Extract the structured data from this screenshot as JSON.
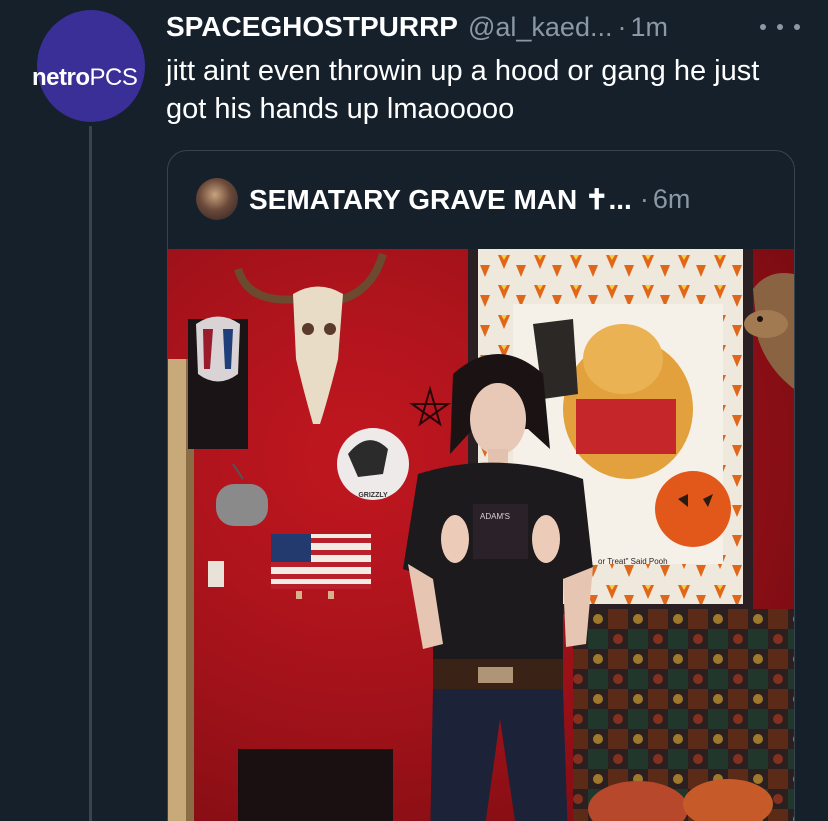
{
  "tweet": {
    "avatar": {
      "logo_bold": "netro",
      "logo_light": "PCS",
      "color": "#3a2f96"
    },
    "display_name": "SPACEGHOSTPURRP",
    "handle": "@al_kaed...",
    "separator": "·",
    "time": "1m",
    "more_icon": "more-horizontal-icon",
    "text": "jitt aint even throwin up a hood or gang he just got his hands up lmaooooo"
  },
  "quote": {
    "display_name": "SEMATARY GRAVE MAN ✝...",
    "separator": "·",
    "time": "6m",
    "photo": {
      "sign_text": "or Treat\" Said Pooh",
      "shirt_text": "ADAM'S",
      "clock_text": "GRIZZLY"
    }
  },
  "colors": {
    "background": "#15202b",
    "primary_text": "#ffffff",
    "secondary_text": "#8b98a5",
    "border": "#38444d",
    "wall_red": "#b3121c"
  }
}
